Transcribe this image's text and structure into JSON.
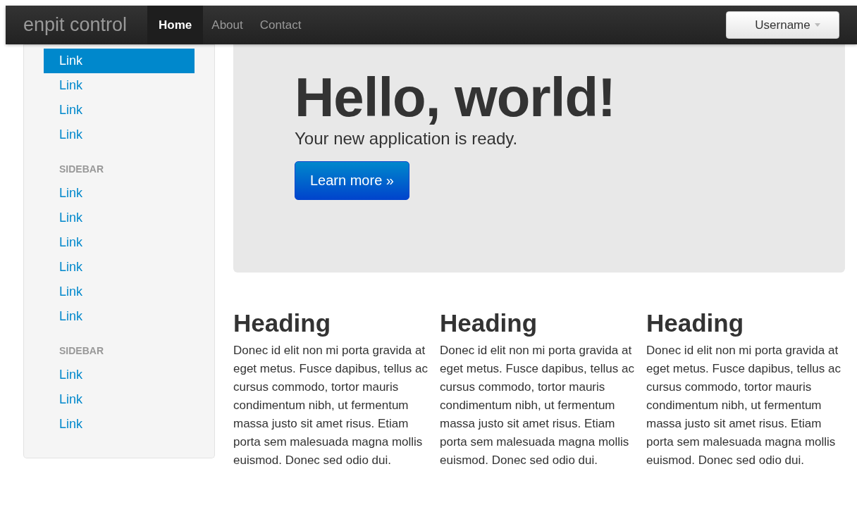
{
  "navbar": {
    "brand": "enpit control",
    "nav": [
      {
        "label": "Home",
        "selected": true
      },
      {
        "label": "About",
        "selected": false
      },
      {
        "label": "Contact",
        "selected": false
      }
    ],
    "user_menu": {
      "label": "Username"
    }
  },
  "sidebar": {
    "sections": [
      {
        "links": [
          {
            "label": "Link",
            "selected": true
          },
          {
            "label": "Link",
            "selected": false
          },
          {
            "label": "Link",
            "selected": false
          },
          {
            "label": "Link",
            "selected": false
          }
        ]
      },
      {
        "header": "SIDEBAR",
        "links": [
          {
            "label": "Link",
            "selected": false
          },
          {
            "label": "Link",
            "selected": false
          },
          {
            "label": "Link",
            "selected": false
          },
          {
            "label": "Link",
            "selected": false
          },
          {
            "label": "Link",
            "selected": false
          },
          {
            "label": "Link",
            "selected": false
          }
        ]
      },
      {
        "header": "SIDEBAR",
        "links": [
          {
            "label": "Link",
            "selected": false
          },
          {
            "label": "Link",
            "selected": false
          },
          {
            "label": "Link",
            "selected": false
          }
        ]
      }
    ]
  },
  "hero": {
    "title": "Hello, world!",
    "subtitle": "Your new application is ready.",
    "button": "Learn more »"
  },
  "columns": [
    {
      "heading": "Heading",
      "text": "Donec id elit non mi porta gravida at eget metus. Fusce dapibus, tellus ac cursus commodo, tortor mauris condimentum nibh, ut fermentum massa justo sit amet risus. Etiam porta sem malesuada magna mollis euismod. Donec sed odio dui."
    },
    {
      "heading": "Heading",
      "text": "Donec id elit non mi porta gravida at eget metus. Fusce dapibus, tellus ac cursus commodo, tortor mauris condimentum nibh, ut fermentum massa justo sit amet risus. Etiam porta sem malesuada magna mollis euismod. Donec sed odio dui."
    },
    {
      "heading": "Heading",
      "text": "Donec id elit non mi porta gravida at eget metus. Fusce dapibus, tellus ac cursus commodo, tortor mauris condimentum nibh, ut fermentum massa justo sit amet risus. Etiam porta sem malesuada magna mollis euismod. Donec sed odio dui."
    }
  ]
}
